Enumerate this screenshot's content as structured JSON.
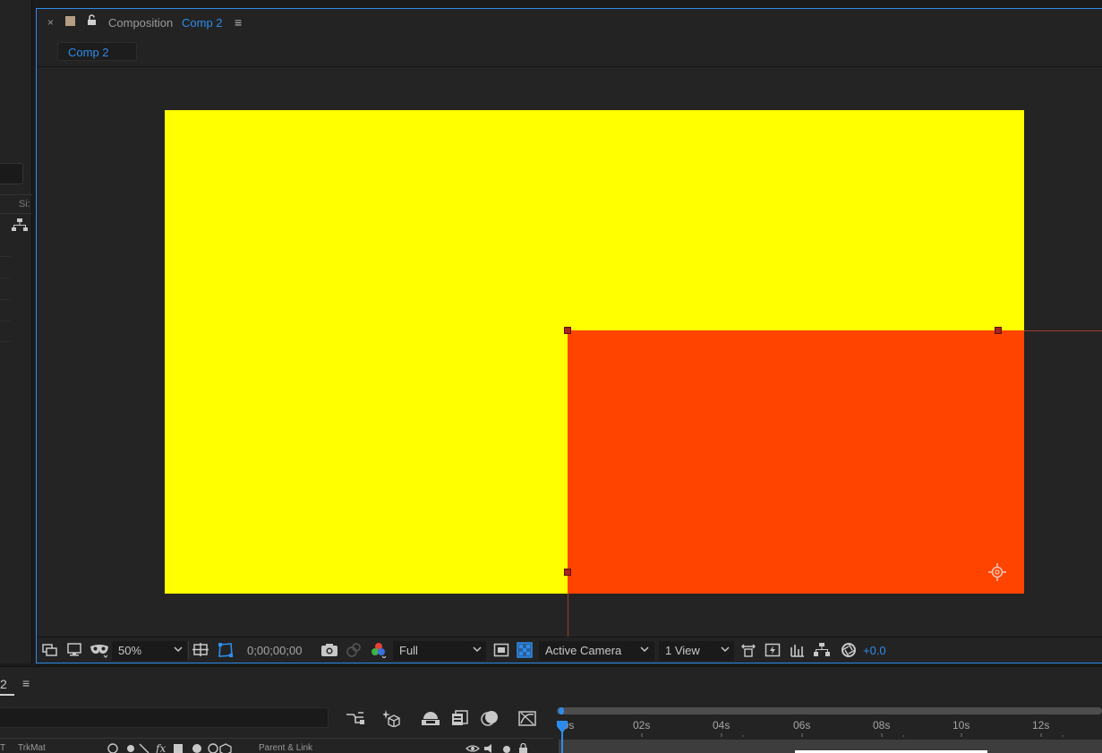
{
  "project_panel": {
    "column_label": "Si:"
  },
  "composition_panel": {
    "close_glyph": "×",
    "title_prefix": "Composition",
    "comp_name": "Comp 2",
    "menu_glyph": "≡",
    "viewer_tab_label": "Comp 2"
  },
  "canvas": {
    "background_color": "#ffff00",
    "layer_color": "#ff4400",
    "guide_color": "#a33a30"
  },
  "viewer_toolbar": {
    "magnification": "50%",
    "timecode": "0;00;00;00",
    "resolution": "Full",
    "camera": "Active Camera",
    "views": "1 View",
    "exposure": "+0.0",
    "icons": [
      "always-preview-icon",
      "monitor-icon",
      "mask-visibility-icon",
      "grid-guides-icon",
      "mask-path-icon",
      "snapshot-icon",
      "show-snapshot-icon",
      "color-channel-icon",
      "region-of-interest-icon",
      "transparency-grid-icon",
      "reset-3d-view-icon",
      "fast-previews-icon",
      "timeline-icon",
      "comp-flowchart-icon",
      "reset-exposure-icon"
    ]
  },
  "timeline": {
    "tab_label": "2",
    "menu_glyph": "≡",
    "columns": [
      "T",
      "TrkMat",
      "Parent & Link"
    ],
    "ruler_labels": [
      "00s",
      "02s",
      "04s",
      "06s",
      "08s",
      "10s",
      "12s"
    ],
    "tools": [
      "comp-mini-flowchart-icon",
      "draft-3d-icon",
      "shy-layers-icon",
      "frame-blending-icon",
      "motion-blur-icon",
      "graph-editor-icon"
    ]
  },
  "colors": {
    "accent": "#2d8ceb",
    "panel": "#232323"
  }
}
